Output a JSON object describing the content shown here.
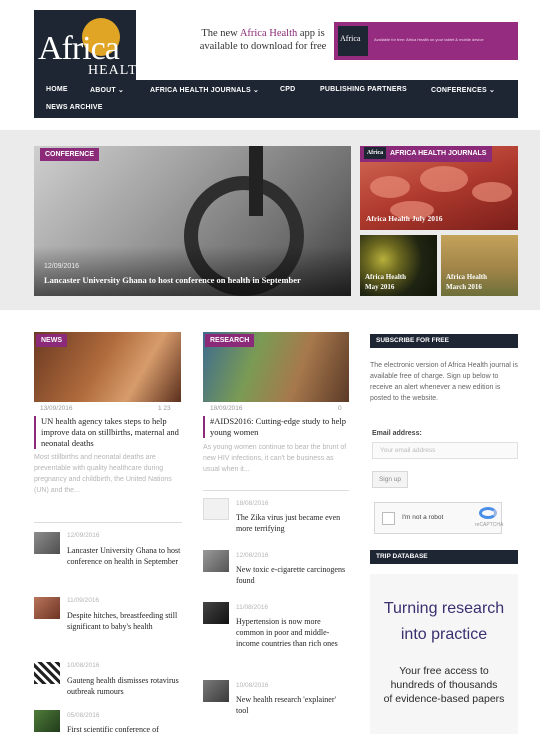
{
  "header": {
    "logo": {
      "word": "Africa",
      "sub": "HEALTH"
    },
    "app_promo": {
      "prefix": "The new ",
      "highlight": "Africa Health",
      "suffix": " app is available to download for free"
    },
    "banner": {
      "tag": "Africa",
      "tagline": "Available for free: Africa Health on your tablet & mobile device"
    }
  },
  "nav": [
    {
      "label": "HOME"
    },
    {
      "label": "ABOUT ⌄"
    },
    {
      "label": "AFRICA HEALTH JOURNALS ⌄"
    },
    {
      "label": "CPD"
    },
    {
      "label": "PUBLISHING PARTNERS"
    },
    {
      "label": "CONFERENCES ⌄"
    },
    {
      "label": "NEWS ARCHIVE"
    }
  ],
  "hero": {
    "badge": "CONFERENCE",
    "date": "12/09/2016",
    "title": "Lancaster University Ghana to host conference on health in September"
  },
  "journals": {
    "badge": "AFRICA HEALTH JOURNALS",
    "badge_logo": "Africa",
    "top_label": "Africa Health July 2016",
    "may_label_1": "Africa Health",
    "may_label_2": "May 2016",
    "march_label_1": "Africa Health",
    "march_label_2": "March 2016"
  },
  "news": {
    "badge": "NEWS",
    "lead": {
      "date": "13/09/2016",
      "count": "1 23",
      "title": "UN health agency takes steps to help improve data on stillbirths, maternal and neonatal deaths",
      "excerpt": "Most stillbirths and neonatal deaths are preventable with quality healthcare during pregnancy and childbirth, the United Nations (UN) and the..."
    },
    "items": [
      {
        "date": "12/09/2016",
        "title": "Lancaster University Ghana to host conference on health in September"
      },
      {
        "date": "11/09/2016",
        "title": "Despite hitches, breastfeeding still significant to baby's health"
      },
      {
        "date": "10/08/2016",
        "title": "Gauteng health dismisses rotavirus outbreak rumours"
      },
      {
        "date": "05/08/2016",
        "title": "First scientific conference of"
      }
    ]
  },
  "research": {
    "badge": "RESEARCH",
    "lead": {
      "date": "18/09/2016",
      "count": "0",
      "title": "#AIDS2016: Cutting-edge study to help young women",
      "excerpt": "As young women continue to bear the brunt of new HIV infections, it can't be business as usual when it..."
    },
    "items": [
      {
        "date": "18/08/2016",
        "title": "The Zika virus just became even more terrifying"
      },
      {
        "date": "12/08/2016",
        "title": "New toxic e-cigarette carcinogens found"
      },
      {
        "date": "11/08/2016",
        "title": "Hypertension is now more common in poor and middle-income countries than rich ones"
      },
      {
        "date": "10/08/2016",
        "title": "New health research 'explainer' tool"
      }
    ]
  },
  "sidebar": {
    "subscribe_head": "SUBSCRIBE FOR FREE",
    "subscribe_text": "The electronic version of Africa Health journal is available free of charge. Sign up below to receive an alert whenever a new edition is posted to the website.",
    "email_label": "Email address:",
    "email_placeholder": "Your email address",
    "signup_label": "Sign up",
    "captcha_label": "I'm not a robot",
    "captcha_brand": "reCAPTCHA",
    "trip_head": "TRIP DATABASE",
    "trip_line1": "Turning research",
    "trip_line2": "into practice",
    "trip_line3": "Your free access to",
    "trip_line4": "hundreds of thousands",
    "trip_line5": "of evidence-based papers"
  },
  "colors": {
    "brand": "#8a2a78",
    "navy": "#1e2633",
    "sun": "#e0a525"
  }
}
